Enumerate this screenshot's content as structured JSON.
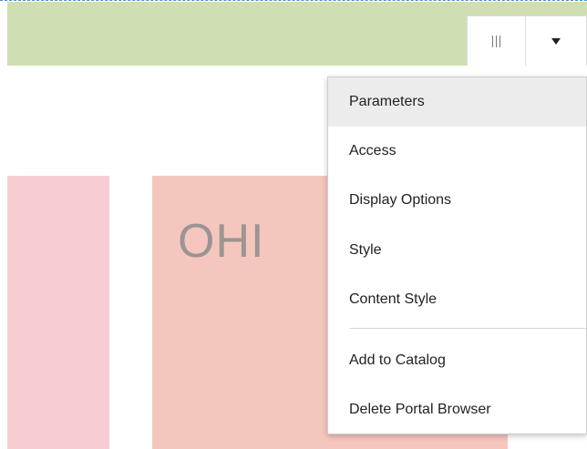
{
  "toolbar": {
    "columns_icon": "columns-icon",
    "dropdown_icon": "caret-down-icon"
  },
  "panels": {
    "salmon_text": "OHI"
  },
  "menu": {
    "items": [
      {
        "label": "Parameters",
        "active": true
      },
      {
        "label": "Access"
      },
      {
        "label": "Display Options"
      },
      {
        "label": "Style"
      },
      {
        "label": "Content Style"
      },
      {
        "label": "Add to Catalog"
      },
      {
        "label": "Delete Portal Browser"
      }
    ]
  },
  "colors": {
    "header_green": "#cfdfb3",
    "panel_pink": "#f7cdd3",
    "panel_salmon": "#f5c6bd",
    "menu_highlight": "#ececec",
    "dashed_border": "#4a90c8"
  }
}
